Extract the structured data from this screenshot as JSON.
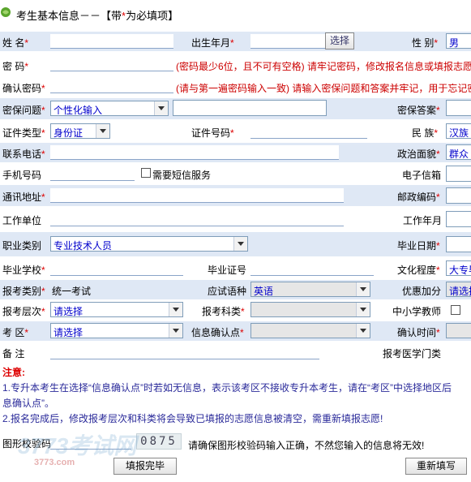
{
  "header": {
    "title_prefix": "考生基本信息－－【带",
    "title_star": "*",
    "title_suffix": "为必填项】"
  },
  "rows": {
    "name": {
      "label": "姓  名"
    },
    "birth": {
      "label": "出生年月",
      "button": "选择"
    },
    "gender": {
      "label": "性  别",
      "value": "男"
    },
    "password": {
      "label": "密  码",
      "hint": "(密码最少6位，且不可有空格) 请牢记密码，修改报名信息或填报志愿"
    },
    "confirm_password": {
      "label": "确认密码",
      "hint": "(请与第一遍密码输入一致) 请输入密保问题和答案并牢记，用于忘记密"
    },
    "security_question": {
      "label": "密保问题",
      "value": "个性化输入"
    },
    "security_answer": {
      "label": "密保答案"
    },
    "id_type": {
      "label": "证件类型",
      "value": "身份证"
    },
    "id_number": {
      "label": "证件号码"
    },
    "ethnicity": {
      "label": "民  族",
      "value": "汉族"
    },
    "phone": {
      "label": "联系电话"
    },
    "political": {
      "label": "政治面貌",
      "value": "群众"
    },
    "mobile": {
      "label": "手机号码",
      "sms_label": "需要短信服务"
    },
    "email": {
      "label": "电子信箱"
    },
    "address": {
      "label": "通讯地址"
    },
    "postcode": {
      "label": "邮政编码"
    },
    "employer": {
      "label": "工作单位"
    },
    "work_year": {
      "label": "工作年月"
    },
    "occupation": {
      "label": "职业类别",
      "value": "专业技术人员"
    },
    "grad_date": {
      "label": "毕业日期"
    },
    "grad_school": {
      "label": "毕业学校"
    },
    "grad_cert": {
      "label": "毕业证号"
    },
    "education": {
      "label": "文化程度",
      "value": "大专毕"
    },
    "exam_type": {
      "label": "报考类别",
      "value": "统一考试"
    },
    "language": {
      "label": "应试语种",
      "value": "英语"
    },
    "bonus": {
      "label": "优惠加分",
      "value": "请选择"
    },
    "level": {
      "label": "报考层次",
      "value": "请选择"
    },
    "subject": {
      "label": "报考科类"
    },
    "teacher": {
      "label": "中小学教师"
    },
    "district": {
      "label": "考  区",
      "value": "请选择"
    },
    "confirm_point": {
      "label": "信息确认点"
    },
    "confirm_time": {
      "label": "确认时间"
    },
    "remarks": {
      "label": "备  注"
    },
    "medical": {
      "label": "报考医学门类"
    }
  },
  "notes": {
    "title": "注意:",
    "line1": "1.专升本考生在选择“信息确认点”时若如无信息，表示该考区不接收专升本考生，请在“考区”中选择地区后",
    "line1b": "息确认点”。",
    "line2": "2.报名完成后，修改报考层次和科类将会导致已填报的志愿信息被清空，需重新填报志愿!"
  },
  "captcha": {
    "label": "图形校验码",
    "code": "0875",
    "hint": "请确保图形校验码输入正确，不然您输入的信息将无效!",
    "watermark": "3773考试网",
    "watermark_url": "3773.com"
  },
  "buttons": {
    "submit": "填报完毕",
    "reset": "重新填写"
  },
  "colors": {
    "band": "#dfe8f5",
    "required": "#dd0000",
    "link_blue": "#0000cc"
  }
}
